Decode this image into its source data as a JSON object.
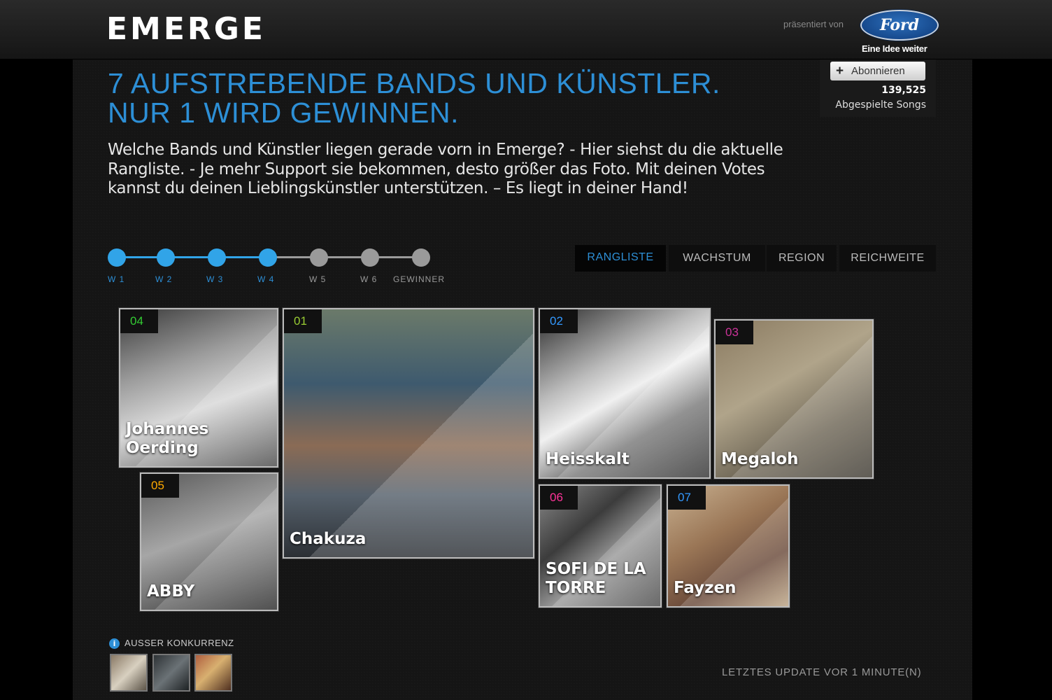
{
  "header": {
    "logo": "EMERGE",
    "presented_by": "präsentiert von",
    "sponsor_logo": "Ford",
    "sponsor_tagline": "Eine Idee weiter"
  },
  "hero": {
    "headline_line1": "7 AUFSTREBENDE BANDS UND KÜNSTLER.",
    "headline_line2": "NUR 1 WIRD GEWINNEN.",
    "intro": "Welche Bands und Künstler liegen gerade vorn in Emerge? - Hier siehst du die aktuelle Rangliste. - Je mehr Support sie bekommen, desto größer das Foto. Mit deinen Votes kannst du deinen Lieblingskünstler unterstützen. – Es liegt in deiner Hand!"
  },
  "subscribe": {
    "button_label": "Abonnieren",
    "songs_count": "139,525",
    "songs_label": "Abgespielte Songs"
  },
  "timeline": {
    "steps": [
      {
        "label": "W 1",
        "active": true
      },
      {
        "label": "W 2",
        "active": true
      },
      {
        "label": "W 3",
        "active": true
      },
      {
        "label": "W 4",
        "active": true
      },
      {
        "label": "W 5",
        "active": false
      },
      {
        "label": "W 6",
        "active": false
      },
      {
        "label": "GEWINNER",
        "active": false
      }
    ]
  },
  "tabs": [
    "RANGLISTE",
    "WACHSTUM",
    "REGION",
    "REICHWEITE"
  ],
  "artists": [
    {
      "rank": "04",
      "name": "Johannes Oerding",
      "rank_color": "#33cc33"
    },
    {
      "rank": "01",
      "name": "Chakuza",
      "rank_color": "#99cc33"
    },
    {
      "rank": "02",
      "name": "Heisskalt",
      "rank_color": "#3399ff"
    },
    {
      "rank": "03",
      "name": "Megaloh",
      "rank_color": "#cc3399"
    },
    {
      "rank": "05",
      "name": "ABBY",
      "rank_color": "#ffaa00"
    },
    {
      "rank": "06",
      "name": "SOFI DE LA TORRE",
      "rank_color": "#ff3399"
    },
    {
      "rank": "07",
      "name": "Fayzen",
      "rank_color": "#3399ff"
    }
  ],
  "out_of_competition": {
    "label": "AUSSER KONKURRENZ",
    "thumb_count": 3
  },
  "footer": {
    "last_update": "LETZTES UPDATE VOR 1 MINUTE(N)"
  }
}
